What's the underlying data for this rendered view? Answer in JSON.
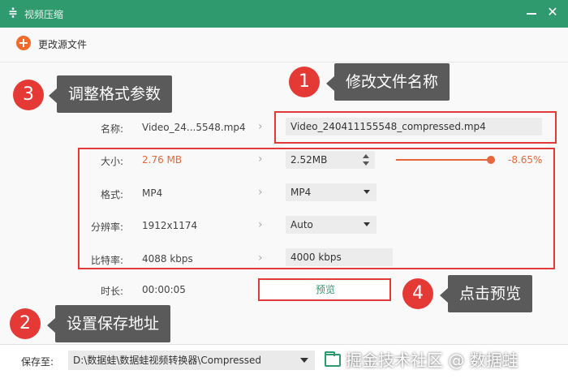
{
  "window": {
    "title": "视频压缩",
    "minimize_icon": "minimize-icon",
    "close_icon": "close-icon",
    "close_glyph": "✕"
  },
  "toolbar": {
    "change_source_label": "更改源文件",
    "plus_glyph": "+"
  },
  "form": {
    "name": {
      "label": "名称:",
      "source": "Video_24...5548.mp4",
      "target": "Video_240411155548_compressed.mp4"
    },
    "size": {
      "label": "大小:",
      "source": "2.76 MB",
      "target": "2.52MB",
      "percent": "-8.65%",
      "slider_value": 0.9135
    },
    "format": {
      "label": "格式:",
      "source": "MP4",
      "target": "MP4"
    },
    "resolution": {
      "label": "分辨率:",
      "source": "1912x1174",
      "target": "Auto"
    },
    "bitrate": {
      "label": "比特率:",
      "source": "4088 kbps",
      "target": "4000 kbps"
    },
    "duration": {
      "label": "时长:",
      "source": "00:00:05"
    },
    "preview_label": "预览",
    "chevron_glyph": "›"
  },
  "annotations": {
    "step1": {
      "number": "1",
      "text": "修改文件名称"
    },
    "step2": {
      "number": "2",
      "text": "设置保存地址"
    },
    "step3": {
      "number": "3",
      "text": "调整格式参数"
    },
    "step4": {
      "number": "4",
      "text": "点击预览"
    },
    "highlight_color": "#e03a3a"
  },
  "bottom": {
    "save_label": "保存至:",
    "save_path": "D:\\数据蛙\\数据蛙视频转换器\\Compressed",
    "watermark": "掘金技术社区 @ 数据蛙"
  },
  "colors": {
    "brand_green": "#2f9a6e",
    "accent_orange": "#e8673a",
    "badge_red": "#e53935",
    "callout_gray": "#5a5a5a"
  }
}
